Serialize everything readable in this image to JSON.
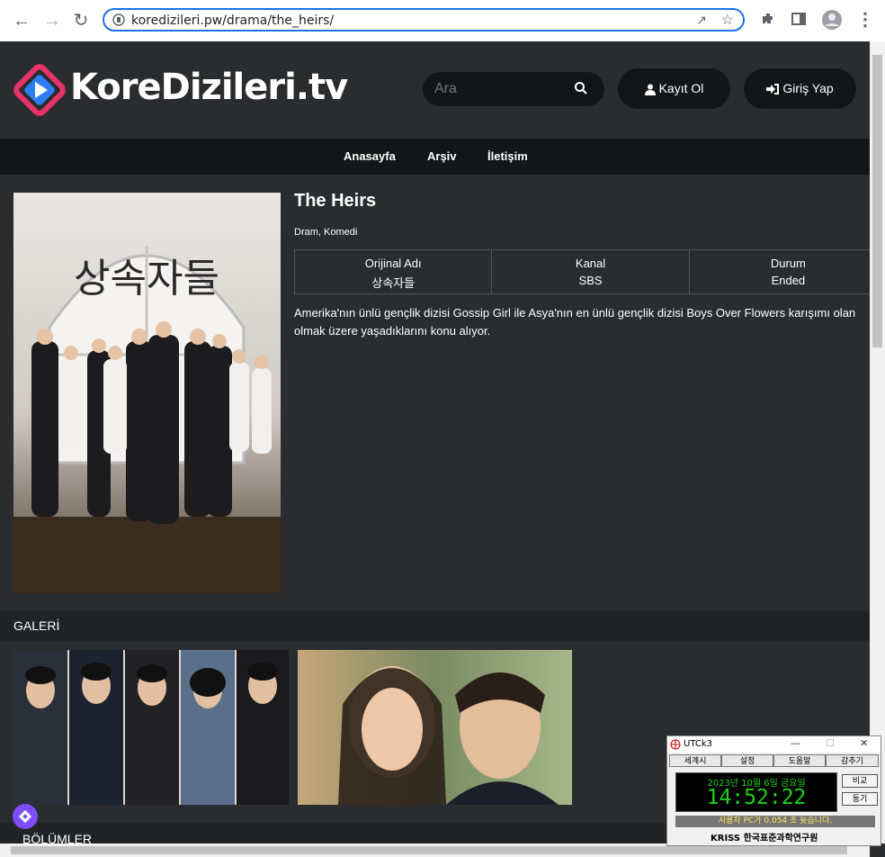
{
  "browser": {
    "url": "koredizileri.pw/drama/the_heirs/"
  },
  "site": {
    "logo_text": "KoreDizileri.tv",
    "search_placeholder": "Ara",
    "register_label": "Kayıt Ol",
    "login_label": "Giriş Yap",
    "menu": [
      "Anasayfa",
      "Arşiv",
      "İletişim"
    ]
  },
  "drama": {
    "title": "The Heirs",
    "poster_title": "상속자들",
    "genres": "Dram, Komedi",
    "info": [
      {
        "label": "Orijinal Adı",
        "value": "상속자들"
      },
      {
        "label": "Kanal",
        "value": "SBS"
      },
      {
        "label": "Durum",
        "value": "Ended"
      }
    ],
    "description_line1": "Amerika'nın ünlü gençlik dizisi Gossip Girl ile Asya'nın en ünlü gençlik dizisi Boys Over Flowers karışımı olan",
    "description_line2": "olmak üzere yaşadıklarını konu alıyor."
  },
  "sections": {
    "gallery_title": "GALERİ",
    "episodes_title": "BÖLÜMLER"
  },
  "utck": {
    "title": "UTCk3",
    "tabs": [
      "세계시",
      "설정",
      "도움말",
      "감추기"
    ],
    "date": "2023년 10월 6일 금요일",
    "time": "14:52:22",
    "compare_label": "비교",
    "sync_label": "동기",
    "status_message": "사용자 PC가 0.054 초 늦습니다.",
    "brand": "KRISS 한국표준과학연구원"
  },
  "colors": {
    "page_bg": "#2b2c30",
    "menu_bg": "#141518",
    "accent_blue": "#1a73e8",
    "logo_pink": "#e8326a",
    "logo_blue": "#2f7df6",
    "clock_green": "#1bd11b"
  }
}
